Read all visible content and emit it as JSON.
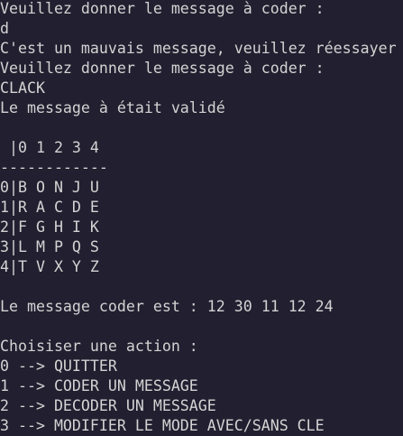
{
  "terminal": {
    "background": "#221f30",
    "foreground": "#d3d3d3",
    "lines": [
      "Veuillez donner le message à coder :",
      "d",
      "C'est un mauvais message, veuillez réessayer",
      "Veuillez donner le message à coder :",
      "CLACK",
      "Le message à était validé",
      "",
      " |0 1 2 3 4",
      "------------",
      "0|B O N J U",
      "1|R A C D E",
      "2|F G H I K",
      "3|L M P Q S",
      "4|T V X Y Z",
      "",
      "Le message coder est : 12 30 11 12 24",
      "",
      "Choisiser une action :",
      "0 --> QUITTER",
      "1 --> CODER UN MESSAGE",
      "2 --> DECODER UN MESSAGE",
      "3 --> MODIFIER LE MODE AVEC/SANS CLE"
    ]
  }
}
